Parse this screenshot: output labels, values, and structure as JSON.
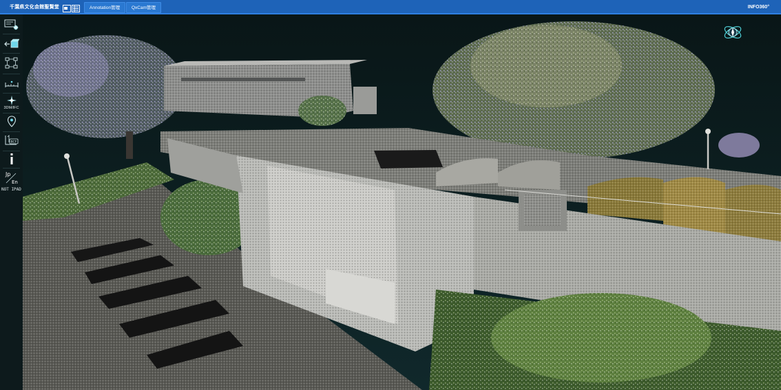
{
  "header": {
    "title": "千葉県文化会館聖賢堂",
    "tabs": [
      {
        "label": "Annotation管理"
      },
      {
        "label": "QxCam管理"
      }
    ],
    "brand": "INFO360°"
  },
  "toolbar": {
    "tools": [
      {
        "name": "view-settings",
        "icon": "monitor-star-icon"
      },
      {
        "name": "navigation",
        "icon": "arrow-cube-icon"
      },
      {
        "name": "structure",
        "icon": "tree-nodes-icon"
      },
      {
        "name": "measure",
        "icon": "ruler-icon"
      },
      {
        "name": "3dm-ifc",
        "icon": "sparkle-icon",
        "label": "3DM/IFC"
      },
      {
        "name": "location",
        "icon": "map-pin-icon"
      },
      {
        "name": "bcf",
        "icon": "bcf-icon",
        "label": "BCF"
      },
      {
        "name": "info",
        "icon": "info-icon"
      },
      {
        "name": "language",
        "icon": "language-icon",
        "label_top": "Jp",
        "label_bottom": "En"
      }
    ],
    "device_label": "NOT IPAD"
  },
  "colors": {
    "header": "#1e63b8",
    "accent": "#2f7fe0",
    "sidebar": "#0d1a1c",
    "viewport_bg": "#0b1d20",
    "compass": "#4fd0d8"
  }
}
